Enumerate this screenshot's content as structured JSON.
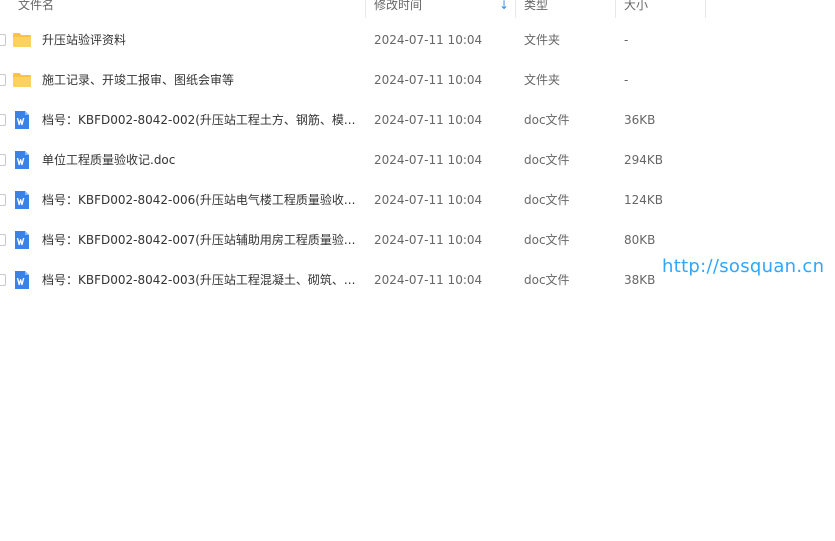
{
  "header": {
    "name": "文件名",
    "time": "修改时间",
    "type": "类型",
    "size": "大小",
    "sort_arrow": "↓"
  },
  "rows": [
    {
      "icon": "folder-icon",
      "name": "升压站验评资料",
      "time": "2024-07-11 10:04",
      "type": "文件夹",
      "size": "-"
    },
    {
      "icon": "folder-icon",
      "name": "施工记录、开竣工报审、图纸会审等",
      "time": "2024-07-11 10:04",
      "type": "文件夹",
      "size": "-"
    },
    {
      "icon": "word-doc-icon",
      "name": "档号：KBFD002-8042-002(升压站工程土方、钢筋、模...",
      "time": "2024-07-11 10:04",
      "type": "doc文件",
      "size": "36KB"
    },
    {
      "icon": "word-doc-icon",
      "name": "单位工程质量验收记.doc",
      "time": "2024-07-11 10:04",
      "type": "doc文件",
      "size": "294KB"
    },
    {
      "icon": "word-doc-icon",
      "name": "档号：KBFD002-8042-006(升压站电气楼工程质量验收...",
      "time": "2024-07-11 10:04",
      "type": "doc文件",
      "size": "124KB"
    },
    {
      "icon": "word-doc-icon",
      "name": "档号：KBFD002-8042-007(升压站辅助用房工程质量验...",
      "time": "2024-07-11 10:04",
      "type": "doc文件",
      "size": "80KB"
    },
    {
      "icon": "word-doc-icon",
      "name": "档号：KBFD002-8042-003(升压站工程混凝土、砌筑、...",
      "time": "2024-07-11 10:04",
      "type": "doc文件",
      "size": "38KB"
    }
  ],
  "watermark": "http://sosquan.cn",
  "colors": {
    "folder": "#f7c443",
    "word": "#3b82e6",
    "watermark": "#2fa6ff",
    "sort_arrow": "#3a8ee6"
  }
}
